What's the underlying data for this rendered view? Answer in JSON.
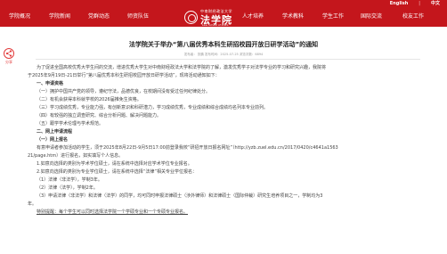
{
  "topbar": {
    "lang_en": "English",
    "separator": "|",
    "lang_zh": "中文"
  },
  "logo": {
    "university": "中南财经政法大学",
    "college": "法学院",
    "english": "Law School of ZUEL"
  },
  "nav": {
    "left": [
      "学院概况",
      "学院新闻",
      "党群动态",
      "师资队伍"
    ],
    "right": [
      "人才培养",
      "学术教科",
      "学生工作",
      "国际交流",
      "校友工作"
    ]
  },
  "share": {
    "label": "分享"
  },
  "article": {
    "title": "法学院关于举办“第八届优秀本科生研招校园开放日研学活动”的通知",
    "meta": "发布者：  张鹏   发布时间：2025-07-25   浏览次数：6894"
  },
  "body": {
    "lines": [
      {
        "text": "为了促进全国高校优秀大学生间的交流，增进优秀大学生对中南财经政法大学和法学院的了解，激发优秀学子对法学专业的学习和研究兴趣，我院将",
        "cls": "indent"
      },
      {
        "text": "于2025年9月19日-21日举行“第八届优秀本科生研招校园开放日研学活动”，现将活动通知如下：",
        "cls": ""
      },
      {
        "text": "一、申请资格",
        "cls": "indent bold"
      },
      {
        "text": "（一）拥护中国共产党的领导，遵纪守法，品德优良，在校期间没有受过任何纪律处分。",
        "cls": "indent"
      },
      {
        "text": "（二）有机会获得本科就学校的2026届推免生资格。",
        "cls": "indent"
      },
      {
        "text": "（三）学习成绩优秀，专业能力强，有创新意识和科研潜力，学习成绩优秀，专业成绩和综合成绩均名列本专业前列。",
        "cls": "indent"
      },
      {
        "text": "（四）有较强的独立调查研究、综合分析问题、解决问题能力。",
        "cls": "indent"
      },
      {
        "text": "（五）跟学学术伦理与学术规范。",
        "cls": "indent"
      },
      {
        "text": "二、网上申请流程",
        "cls": "indent bold"
      },
      {
        "text": "（一）网上报名",
        "cls": "indent bold"
      },
      {
        "text": "有意申请者参加活动的学生，须于2025年8月22日-9月5日17:00前登录我校“研招开放日报名网址”（http://yzb.zuel.edu.cn/2017/0420/c4641a1563",
        "cls": "indent"
      },
      {
        "text": "21/page.htm）进行报名，如实填写个人信息。",
        "cls": ""
      },
      {
        "text": "1.如意向选择的类别为学术学位硕士，请在系统中选择对应学术学位专业报名。",
        "cls": "indent"
      },
      {
        "text": "2.如意向选择的类别为专业学位硕士，请在系统中选择“法律”相关专业学位报名：",
        "cls": "indent"
      },
      {
        "text": "（1）法律（非法学），学制3年。",
        "cls": "indent"
      },
      {
        "text": "（2）法律（法学），学制2年。",
        "cls": "indent"
      },
      {
        "text": "（3）申请法律（非法学）和法律（法学）的同学，均可同时申报法律硕士（涉外律师）和法律硕士（国际仲裁）研究生培养项目之一，学制均为3",
        "cls": "indent"
      },
      {
        "text": "年。",
        "cls": ""
      },
      {
        "text": "特别提醒：每个学生可以同时选择法学院一个学硕专业和一个专硕专业报名。",
        "cls": "indent ul"
      }
    ]
  }
}
